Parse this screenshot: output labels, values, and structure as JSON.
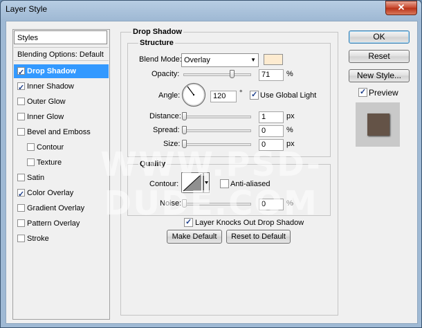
{
  "window": {
    "title": "Layer Style",
    "close_symbol": "✕"
  },
  "styles_panel": {
    "header": "Styles",
    "blending_options": "Blending Options: Default",
    "items": [
      {
        "label": "Drop Shadow",
        "checked": true,
        "selected": true
      },
      {
        "label": "Inner Shadow",
        "checked": true,
        "selected": false
      },
      {
        "label": "Outer Glow",
        "checked": false,
        "selected": false
      },
      {
        "label": "Inner Glow",
        "checked": false,
        "selected": false
      },
      {
        "label": "Bevel and Emboss",
        "checked": false,
        "selected": false
      },
      {
        "label": "Contour",
        "checked": false,
        "selected": false,
        "indent": true
      },
      {
        "label": "Texture",
        "checked": false,
        "selected": false,
        "indent": true
      },
      {
        "label": "Satin",
        "checked": false,
        "selected": false
      },
      {
        "label": "Color Overlay",
        "checked": true,
        "selected": false
      },
      {
        "label": "Gradient Overlay",
        "checked": false,
        "selected": false
      },
      {
        "label": "Pattern Overlay",
        "checked": false,
        "selected": false
      },
      {
        "label": "Stroke",
        "checked": false,
        "selected": false
      }
    ]
  },
  "drop_shadow": {
    "title": "Drop Shadow",
    "structure": {
      "title": "Structure",
      "blend_mode_label": "Blend Mode:",
      "blend_mode_value": "Overlay",
      "blend_color": "#fdebd0",
      "opacity_label": "Opacity:",
      "opacity_value": "71",
      "opacity_unit": "%",
      "angle_label": "Angle:",
      "angle_value": "120",
      "angle_unit": "°",
      "use_global_light_label": "Use Global Light",
      "use_global_light_checked": true,
      "distance_label": "Distance:",
      "distance_value": "1",
      "distance_unit": "px",
      "spread_label": "Spread:",
      "spread_value": "0",
      "spread_unit": "%",
      "size_label": "Size:",
      "size_value": "0",
      "size_unit": "px"
    },
    "quality": {
      "title": "Quality",
      "contour_label": "Contour:",
      "anti_aliased_label": "Anti-aliased",
      "anti_aliased_checked": false,
      "noise_label": "Noise:",
      "noise_value": "0",
      "noise_unit": "%"
    },
    "layer_knocks_out_label": "Layer Knocks Out Drop Shadow",
    "layer_knocks_out_checked": true,
    "make_default_label": "Make Default",
    "reset_to_default_label": "Reset to Default"
  },
  "actions": {
    "ok_label": "OK",
    "reset_label": "Reset",
    "new_style_label": "New Style...",
    "preview_label": "Preview",
    "preview_checked": true,
    "preview_color": "#645347"
  },
  "watermark": "WWW.PSD-DUDE.COM"
}
